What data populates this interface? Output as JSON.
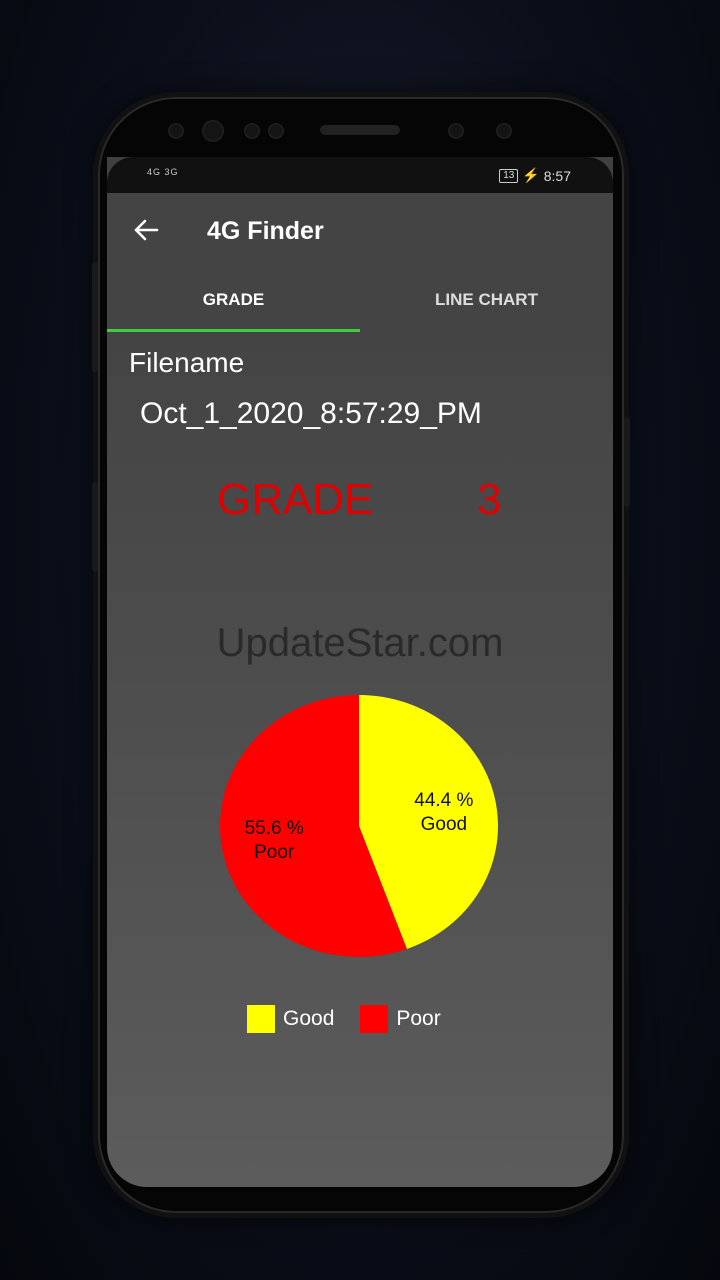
{
  "status": {
    "signal_left": "4G 3G",
    "battery": "13",
    "time": "8:57"
  },
  "app": {
    "title": "4G Finder",
    "back_icon": "arrow-left-icon"
  },
  "tabs": [
    {
      "label": "GRADE",
      "selected": true
    },
    {
      "label": "LINE CHART",
      "selected": false
    }
  ],
  "content": {
    "filename_label": "Filename",
    "filename_value": "Oct_1_2020_8:57:29_PM",
    "grade_label": "GRADE",
    "grade_value": "3",
    "watermark": "UpdateStar.com"
  },
  "colors": {
    "accent": "#3ecf3e",
    "grade": "#e00000",
    "good": "#ffff00",
    "poor": "#ff0000"
  },
  "chart_data": {
    "type": "pie",
    "categories": [
      "Good",
      "Poor"
    ],
    "values": [
      44.4,
      55.6
    ],
    "slice_labels": [
      {
        "percent": "44.4 %",
        "name": "Good"
      },
      {
        "percent": "55.6 %",
        "name": "Poor"
      }
    ],
    "legend": [
      {
        "label": "Good"
      },
      {
        "label": "Poor"
      }
    ]
  }
}
